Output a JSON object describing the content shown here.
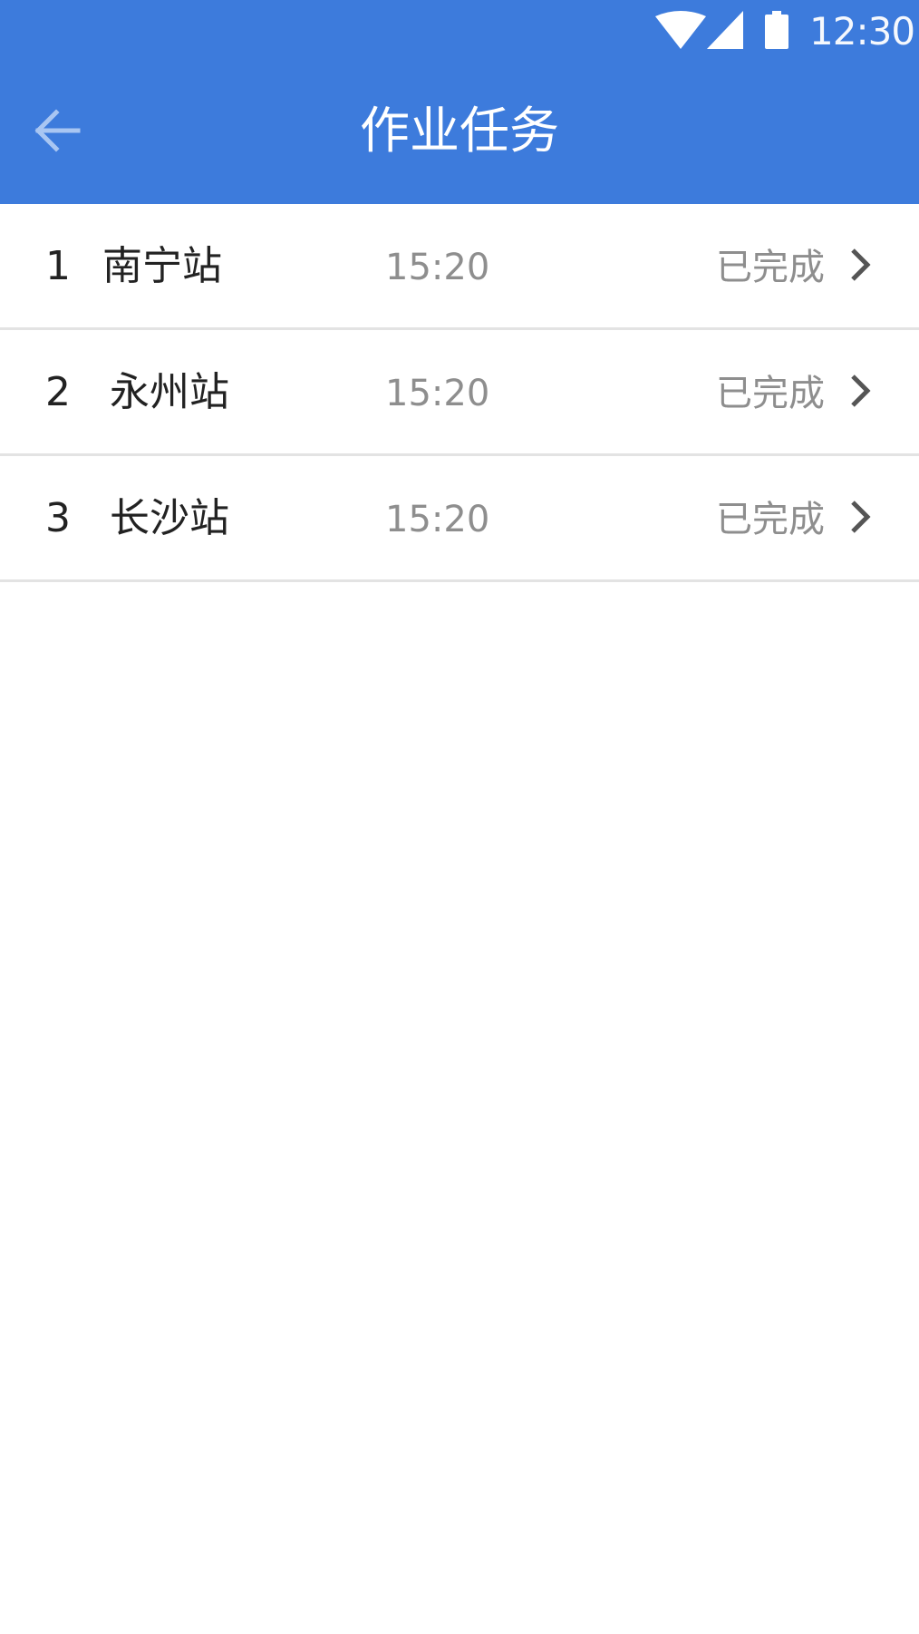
{
  "status_bar": {
    "time": "12:30",
    "icons": [
      "wifi-icon",
      "cell-signal-icon",
      "battery-icon"
    ]
  },
  "app_bar": {
    "title": "作业任务",
    "back_icon": "arrow-left-icon",
    "color": "#3d7bdc"
  },
  "tasks": [
    {
      "index": "1",
      "station": "南宁站",
      "time": "15:20",
      "status": "已完成"
    },
    {
      "index": "2",
      "station": "永州站",
      "time": "15:20",
      "status": "已完成"
    },
    {
      "index": "3",
      "station": "长沙站",
      "time": "15:20",
      "status": "已完成"
    }
  ],
  "colors": {
    "primary": "#3d7bdc",
    "text_primary": "#222222",
    "text_secondary": "#8e8e8e",
    "divider": "#e3e3e3"
  }
}
